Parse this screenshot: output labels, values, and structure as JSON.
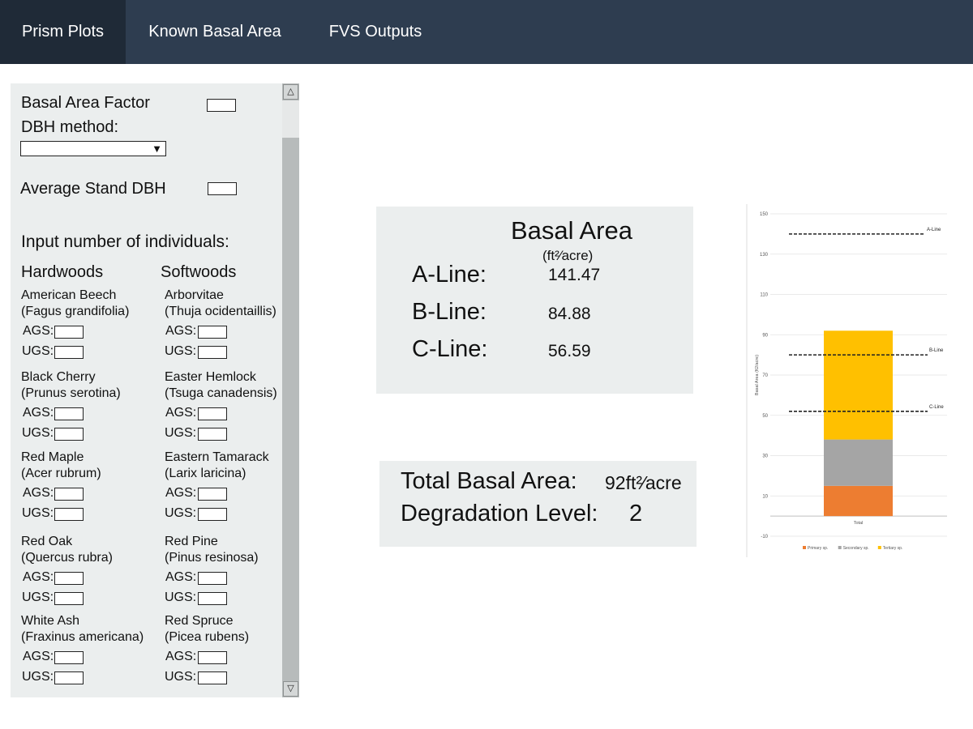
{
  "nav": {
    "tabs": [
      {
        "label": "Prism Plots"
      },
      {
        "label": "Known Basal Area"
      },
      {
        "label": "FVS Outputs"
      }
    ]
  },
  "sidebar": {
    "baf_label": "Basal Area Factor",
    "baf_value": "",
    "dbh_method_label": "DBH method:",
    "dbh_method_value": "",
    "avg_dbh_label": "Average Stand DBH",
    "avg_dbh_value": "",
    "input_heading": "Input number of individuals:",
    "hardwoods_heading": "Hardwoods",
    "softwoods_heading": "Softwoods",
    "ags_label": "AGS:",
    "ugs_label": "UGS:",
    "hardwoods": [
      {
        "common": "American Beech",
        "latin": "(Fagus grandifolia)",
        "ags": "",
        "ugs": ""
      },
      {
        "common": "Black Cherry",
        "latin": "(Prunus serotina)",
        "ags": "",
        "ugs": ""
      },
      {
        "common": "Red Maple",
        "latin": "(Acer rubrum)",
        "ags": "",
        "ugs": ""
      },
      {
        "common": "Red Oak",
        "latin": "(Quercus rubra)",
        "ags": "",
        "ugs": ""
      },
      {
        "common": "White Ash",
        "latin": "(Fraxinus americana)",
        "ags": "",
        "ugs": ""
      }
    ],
    "softwoods": [
      {
        "common": "Arborvitae",
        "latin": "(Thuja ocidentaillis)",
        "ags": "",
        "ugs": ""
      },
      {
        "common": "Easter Hemlock",
        "latin": "(Tsuga canadensis)",
        "ags": "",
        "ugs": ""
      },
      {
        "common": "Eastern Tamarack",
        "latin": "(Larix laricina)",
        "ags": "",
        "ugs": ""
      },
      {
        "common": "Red Pine",
        "latin": "(Pinus resinosa)",
        "ags": "",
        "ugs": ""
      },
      {
        "common": "Red Spruce",
        "latin": "(Picea rubens)",
        "ags": "",
        "ugs": ""
      }
    ],
    "scroll_up_icon": "triangle-up-icon",
    "scroll_down_icon": "triangle-down-icon"
  },
  "basal_card": {
    "title": "Basal Area",
    "unit": "(ft²⁄acre)",
    "rows": [
      {
        "label": "A-Line:",
        "value": "141.47"
      },
      {
        "label": "B-Line:",
        "value": "84.88"
      },
      {
        "label": "C-Line:",
        "value": "56.59"
      }
    ]
  },
  "total_card": {
    "total_label": "Total Basal Area:",
    "total_value": "92ft²⁄acre",
    "degradation_label": "Degradation Level:",
    "degradation_value": "2"
  },
  "colors": {
    "nav_bg": "#2e3d50",
    "nav_active": "#1f2a37",
    "primary": "#ed7d31",
    "secondary": "#a5a5a5",
    "tertiary": "#ffc000"
  },
  "chart_data": {
    "type": "bar",
    "stacked": true,
    "categories": [
      "Total"
    ],
    "series": [
      {
        "name": "Primary sp.",
        "values": [
          15
        ],
        "color": "#ed7d31"
      },
      {
        "name": "Secondary sp.",
        "values": [
          23
        ],
        "color": "#a5a5a5"
      },
      {
        "name": "Tertiary sp.",
        "values": [
          54
        ],
        "color": "#ffc000"
      }
    ],
    "reference_lines": [
      {
        "label": "A-Line",
        "value": 140
      },
      {
        "label": "B-Line",
        "value": 80
      },
      {
        "label": "C-Line",
        "value": 52
      }
    ],
    "ylabel": "Basal Area (ft2/acre)",
    "xlabel": "",
    "ylim": [
      -10,
      150
    ],
    "yticks": [
      -10,
      10,
      30,
      50,
      70,
      90,
      110,
      130,
      150
    ],
    "grid": true,
    "legend": "bottom"
  }
}
